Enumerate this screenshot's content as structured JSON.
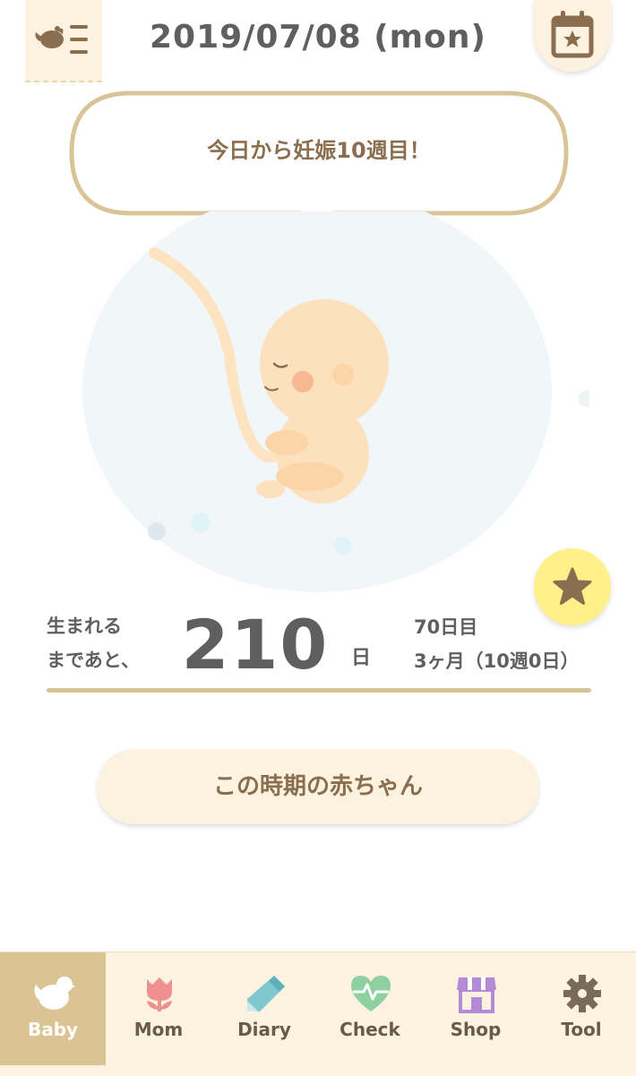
{
  "header": {
    "menu_icon": "bird-menu-icon",
    "date_label": "2019/07/08 (mon)",
    "calendar_icon": "calendar-star-icon"
  },
  "speech_bubble": {
    "text": "今日から妊娠10週目！"
  },
  "illustration": {
    "subject": "fetus-illustration"
  },
  "favorite_button": {
    "icon": "star-icon",
    "color": "#fff08a"
  },
  "countdown": {
    "label_line1": "生まれる",
    "label_line2": "まであと、",
    "days_remaining": "210",
    "days_unit": "日",
    "day_count": "70日目",
    "week_count": "3ヶ月（10週0日）"
  },
  "baby_info_button": {
    "label": "この時期の赤ちゃん"
  },
  "tabbar": {
    "active_color": "#dcc394",
    "background": "#fbf3df",
    "tabs": [
      {
        "label": "Baby",
        "icon": "bird-icon",
        "active": true
      },
      {
        "label": "Mom",
        "icon": "tulip-icon",
        "active": false
      },
      {
        "label": "Diary",
        "icon": "pencil-icon",
        "active": false
      },
      {
        "label": "Check",
        "icon": "heart-pulse-icon",
        "active": false
      },
      {
        "label": "Shop",
        "icon": "store-icon",
        "active": false
      },
      {
        "label": "Tool",
        "icon": "gear-icon",
        "active": false
      }
    ]
  }
}
